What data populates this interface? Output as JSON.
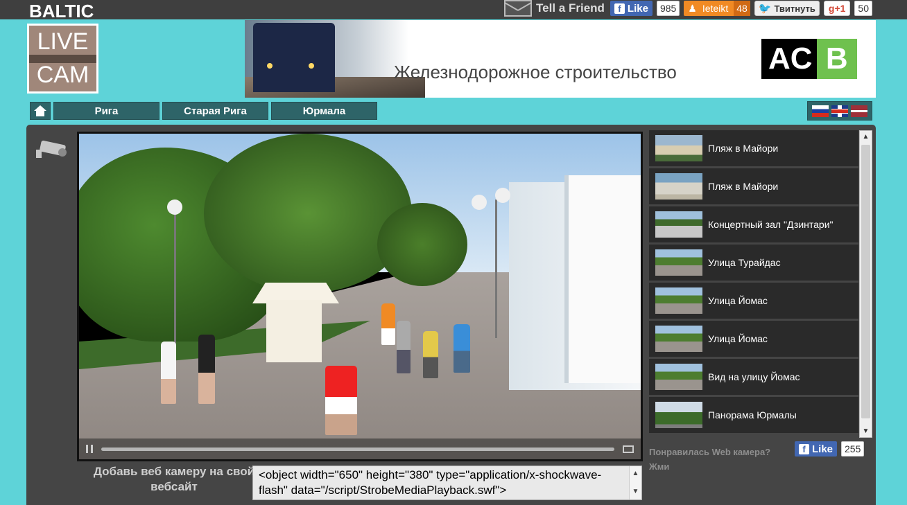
{
  "topbar": {
    "tell_friend": "Tell a Friend",
    "fb_like_label": "Like",
    "fb_like_count": "985",
    "draugiem_label": "Ieteikt",
    "draugiem_count": "48",
    "twitter_label": "Твитнуть",
    "gplus_label": "+1",
    "gplus_count": "50"
  },
  "logo": {
    "line1": "BALTIC",
    "line2": "LIVE",
    "line3": "CAM"
  },
  "banner": {
    "text": "Железнодорожное строительство",
    "brand_left": "AC",
    "brand_right": "B"
  },
  "nav": {
    "items": [
      {
        "label": "Рига"
      },
      {
        "label": "Старая Рига"
      },
      {
        "label": "Юрмала"
      }
    ]
  },
  "video": {
    "progress": 1.0
  },
  "embed": {
    "label": "Добавь веб камеру на свой вебсайт",
    "code": "<object width=\"650\" height=\"380\" type=\"application/x-shockwave-flash\" data=\"/script/StrobeMediaPlayback.swf\">"
  },
  "camera_list": [
    {
      "title": "Пляж в Майори",
      "thumb": "beach"
    },
    {
      "title": "Пляж в Майори",
      "thumb": "beach2"
    },
    {
      "title": "Концертный зал \"Дзинтари\"",
      "thumb": "hall"
    },
    {
      "title": "Улица Турайдас",
      "thumb": "street"
    },
    {
      "title": "Улица Йомас",
      "thumb": "street"
    },
    {
      "title": "Улица Йомас",
      "thumb": "street"
    },
    {
      "title": "Вид на улицу Йомас",
      "thumb": "street"
    },
    {
      "title": "Панорама Юрмалы",
      "thumb": "pano"
    }
  ],
  "like_box": {
    "text": "Понравилась Web камера? Жми",
    "fb_label": "Like",
    "fb_count": "255"
  },
  "colors": {
    "page_bg": "#5ed3d8",
    "nav_bg": "#2e6468",
    "panel_bg": "#454545",
    "list_item_bg": "#2a2a2a",
    "facebook": "#4267b2"
  }
}
